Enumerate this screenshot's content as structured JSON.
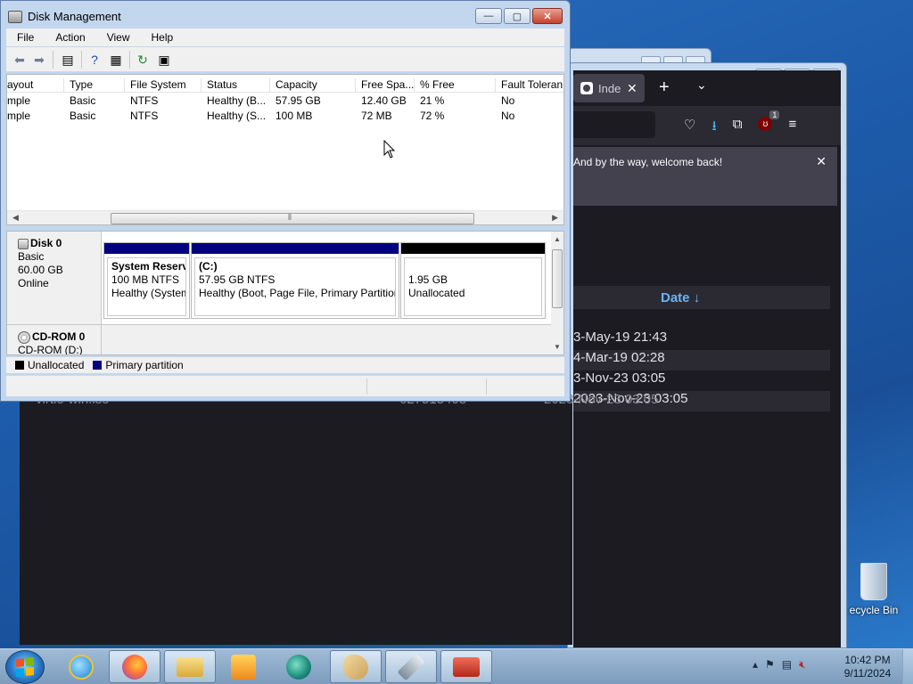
{
  "firefox": {
    "tab_title": "Inde",
    "new_tab": "+",
    "tab_list": "⌄",
    "notice": "And by the way, welcome back!",
    "notice_close": "✕",
    "ublock_badge": "1",
    "sort_column": "Date ↓",
    "rows": [
      "3-May-19 21:43",
      "4-Mar-19 02:28",
      "3-Nov-23 03:05",
      "2023-Nov-23 03:05"
    ]
  },
  "background_file": {
    "name": "virtio-win.iso",
    "size": "627515408",
    "date": "2023-Nov-23 03:05"
  },
  "disk_management": {
    "title": "Disk Management",
    "menu": [
      "File",
      "Action",
      "View",
      "Help"
    ],
    "columns": [
      "ayout",
      "Type",
      "File System",
      "Status",
      "Capacity",
      "Free Spa...",
      "% Free",
      "Fault Toleran"
    ],
    "volumes": [
      {
        "layout": "mple",
        "type": "Basic",
        "fs": "NTFS",
        "status": "Healthy (B...",
        "capacity": "57.95 GB",
        "free": "12.40 GB",
        "pct": "21 %",
        "fault": "No"
      },
      {
        "layout": "mple",
        "type": "Basic",
        "fs": "NTFS",
        "status": "Healthy (S...",
        "capacity": "100 MB",
        "free": "72 MB",
        "pct": "72 %",
        "fault": "No"
      }
    ],
    "disk0": {
      "name": "Disk 0",
      "type": "Basic",
      "size": "60.00 GB",
      "state": "Online"
    },
    "partitions": [
      {
        "name": "System Reserv",
        "detail": "100 MB NTFS",
        "status": "Healthy (System"
      },
      {
        "name": "(C:)",
        "detail": "57.95 GB NTFS",
        "status": "Healthy (Boot, Page File, Primary Partitior"
      },
      {
        "name": "",
        "detail": "1.95 GB",
        "status": "Unallocated"
      }
    ],
    "cdrom": {
      "name": "CD-ROM 0",
      "drive": "CD-ROM (D:)"
    },
    "legend": {
      "unallocated": "Unallocated",
      "primary": "Primary partition"
    },
    "colors": {
      "primary": "#000080",
      "unallocated": "#000000"
    }
  },
  "desktop": {
    "recycle_bin": "ecycle Bin"
  },
  "taskbar": {
    "time": "10:42 PM",
    "date": "9/11/2024"
  }
}
